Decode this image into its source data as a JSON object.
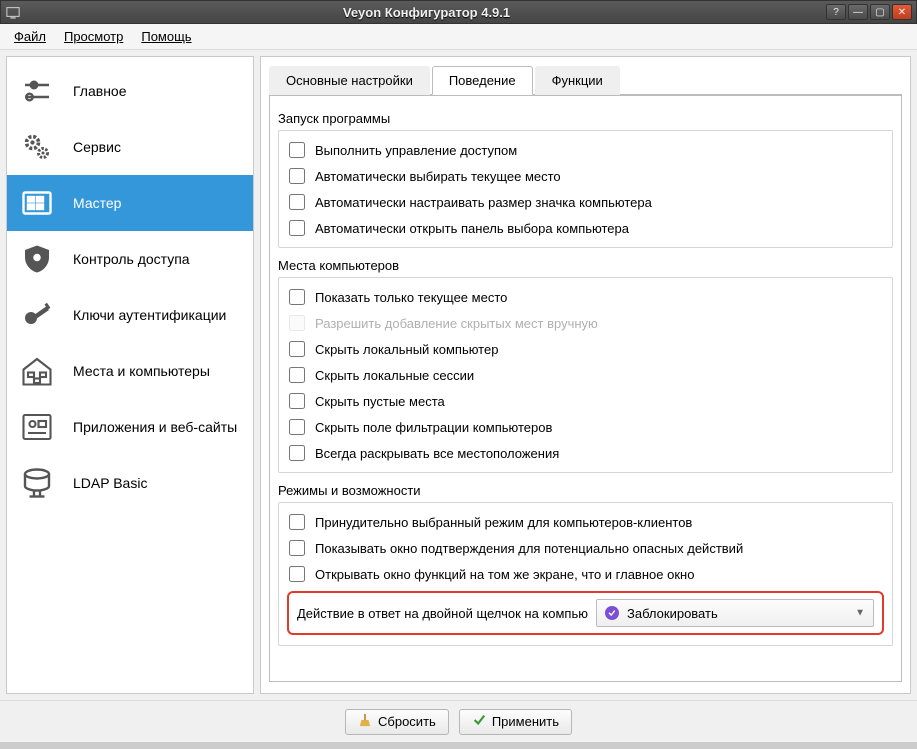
{
  "window": {
    "title": "Veyon Конфигуратор 4.9.1"
  },
  "menu": {
    "file": "Файл",
    "view": "Просмотр",
    "help": "Помощь"
  },
  "sidebar": {
    "items": [
      {
        "label": "Главное"
      },
      {
        "label": "Сервис"
      },
      {
        "label": "Мастер"
      },
      {
        "label": "Контроль доступа"
      },
      {
        "label": "Ключи аутентификации"
      },
      {
        "label": "Места и компьютеры"
      },
      {
        "label": "Приложения и веб-сайты"
      },
      {
        "label": "LDAP Basic"
      }
    ],
    "selected_index": 2
  },
  "tabs": {
    "items": [
      {
        "label": "Основные настройки"
      },
      {
        "label": "Поведение"
      },
      {
        "label": "Функции"
      }
    ],
    "active_index": 1
  },
  "groups": {
    "startup": {
      "title": "Запуск программы",
      "options": [
        {
          "label": "Выполнить управление доступом",
          "checked": false
        },
        {
          "label": "Автоматически выбирать текущее место",
          "checked": false
        },
        {
          "label": "Автоматически настраивать размер значка компьютера",
          "checked": false
        },
        {
          "label": "Автоматически открыть панель выбора компьютера",
          "checked": false
        }
      ]
    },
    "locations": {
      "title": "Места компьютеров",
      "options": [
        {
          "label": "Показать только текущее место",
          "checked": false,
          "disabled": false
        },
        {
          "label": "Разрешить добавление скрытых мест вручную",
          "checked": false,
          "disabled": true
        },
        {
          "label": "Скрыть локальный компьютер",
          "checked": false,
          "disabled": false
        },
        {
          "label": "Скрыть локальные сессии",
          "checked": false,
          "disabled": false
        },
        {
          "label": "Скрыть пустые места",
          "checked": false,
          "disabled": false
        },
        {
          "label": "Скрыть поле фильтрации компьютеров",
          "checked": false,
          "disabled": false
        },
        {
          "label": "Всегда раскрывать все местоположения",
          "checked": false,
          "disabled": false
        }
      ]
    },
    "modes": {
      "title": "Режимы и возможности",
      "options": [
        {
          "label": "Принудительно выбранный режим для компьютеров-клиентов",
          "checked": false
        },
        {
          "label": "Показывать окно подтверждения для потенциально опасных действий",
          "checked": false
        },
        {
          "label": "Открывать окно функций на том же экране, что и главное окно",
          "checked": false
        }
      ],
      "dblclick_label": "Действие в ответ на двойной щелчок на компью",
      "dblclick_value": "Заблокировать"
    }
  },
  "footer": {
    "reset": "Сбросить",
    "apply": "Применить"
  }
}
